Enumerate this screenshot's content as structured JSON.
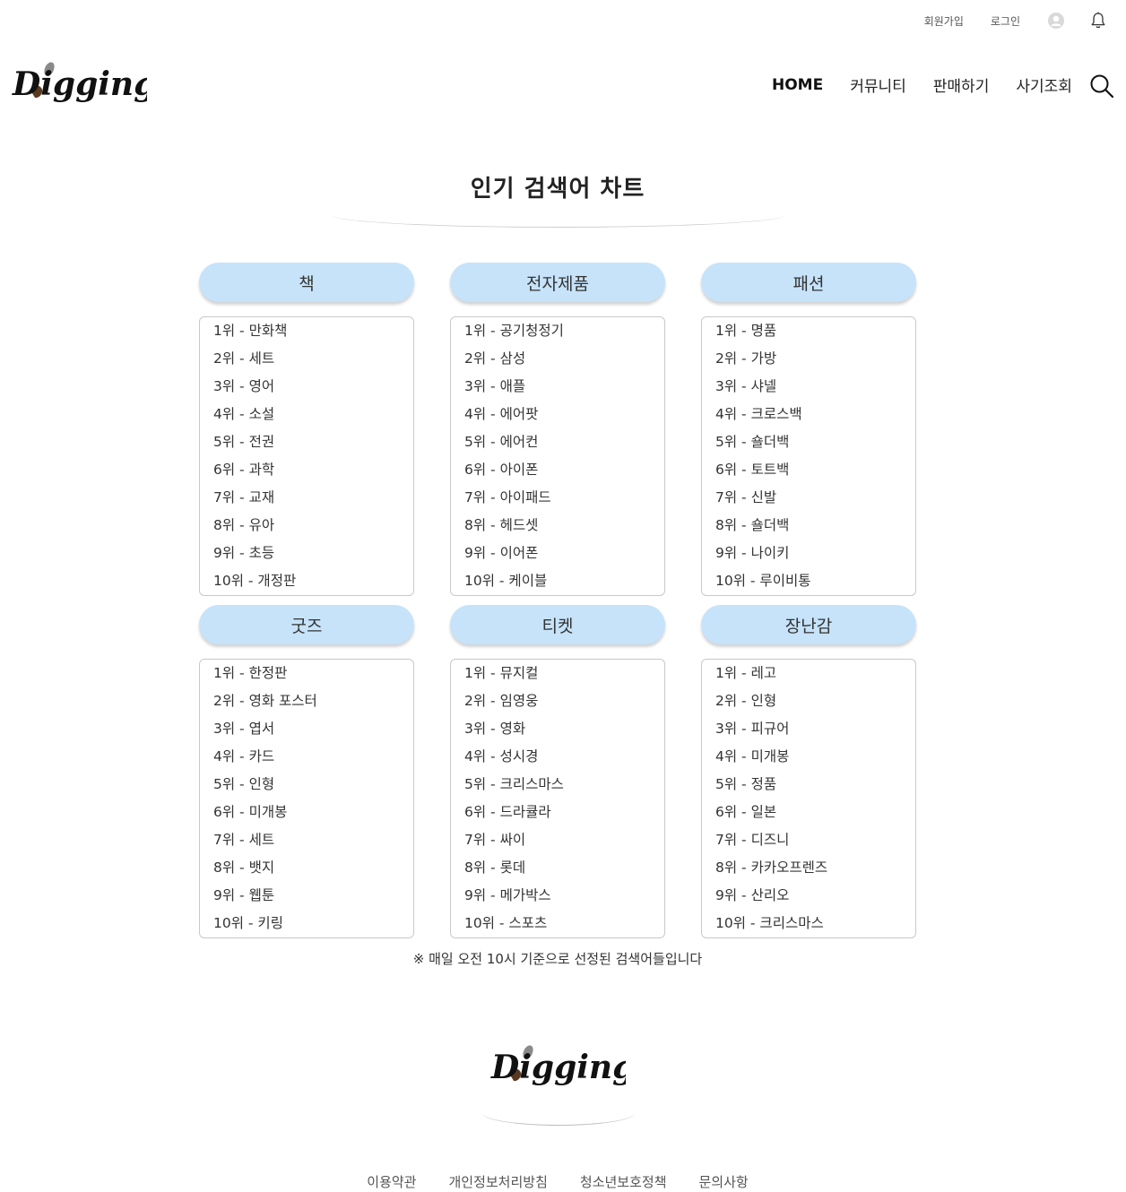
{
  "topbar": {
    "signup": "회원가입",
    "login": "로그인",
    "profile_icon": "user-circle-icon",
    "notification_icon": "bell-icon"
  },
  "header": {
    "logo_text": "Digging",
    "nav": [
      {
        "label": "HOME",
        "active": true
      },
      {
        "label": "커뮤니티",
        "active": false
      },
      {
        "label": "판매하기",
        "active": false
      },
      {
        "label": "사기조회",
        "active": false
      }
    ],
    "search_icon": "search-icon"
  },
  "main": {
    "title": "인기 검색어 차트",
    "categories": [
      {
        "name": "책",
        "items": [
          "1위 - 만화책",
          "2위 - 세트",
          "3위 - 영어",
          "4위 - 소설",
          "5위 - 전권",
          "6위 - 과학",
          "7위 - 교재",
          "8위 - 유아",
          "9위 - 초등",
          "10위 - 개정판"
        ]
      },
      {
        "name": "전자제품",
        "items": [
          "1위 - 공기청정기",
          "2위 - 삼성",
          "3위 - 애플",
          "4위 - 에어팟",
          "5위 - 에어컨",
          "6위 - 아이폰",
          "7위 - 아이패드",
          "8위 - 헤드셋",
          "9위 - 이어폰",
          "10위 - 케이블"
        ]
      },
      {
        "name": "패션",
        "items": [
          "1위 - 명품",
          "2위 - 가방",
          "3위 - 샤넬",
          "4위 - 크로스백",
          "5위 - 숄더백",
          "6위 - 토트백",
          "7위 - 신발",
          "8위 - 숄더백",
          "9위 - 나이키",
          "10위 - 루이비통"
        ]
      },
      {
        "name": "굿즈",
        "items": [
          "1위 - 한정판",
          "2위 - 영화 포스터",
          "3위 - 엽서",
          "4위 - 카드",
          "5위 - 인형",
          "6위 - 미개봉",
          "7위 - 세트",
          "8위 - 뱃지",
          "9위 - 웹툰",
          "10위 - 키링"
        ]
      },
      {
        "name": "티켓",
        "items": [
          "1위 - 뮤지컬",
          "2위 - 임영웅",
          "3위 - 영화",
          "4위 - 성시경",
          "5위 - 크리스마스",
          "6위 - 드라큘라",
          "7위 - 싸이",
          "8위 - 롯데",
          "9위 - 메가박스",
          "10위 - 스포츠"
        ]
      },
      {
        "name": "장난감",
        "items": [
          "1위 - 레고",
          "2위 - 인형",
          "3위 - 피규어",
          "4위 - 미개봉",
          "5위 - 정품",
          "6위 - 일본",
          "7위 - 디즈니",
          "8위 - 카카오프렌즈",
          "9위 - 산리오",
          "10위 - 크리스마스"
        ]
      }
    ],
    "notice": "※ 매일 오전 10시 기준으로 선정된 검색어들입니다"
  },
  "footer": {
    "logo_text": "Digging",
    "links": [
      "이용약관",
      "개인정보처리방침",
      "청소년보호정책",
      "문의사항"
    ]
  },
  "colors": {
    "category_header_bg": "#c6e3fa",
    "list_border": "#c9c9c9",
    "text": "#222222"
  }
}
